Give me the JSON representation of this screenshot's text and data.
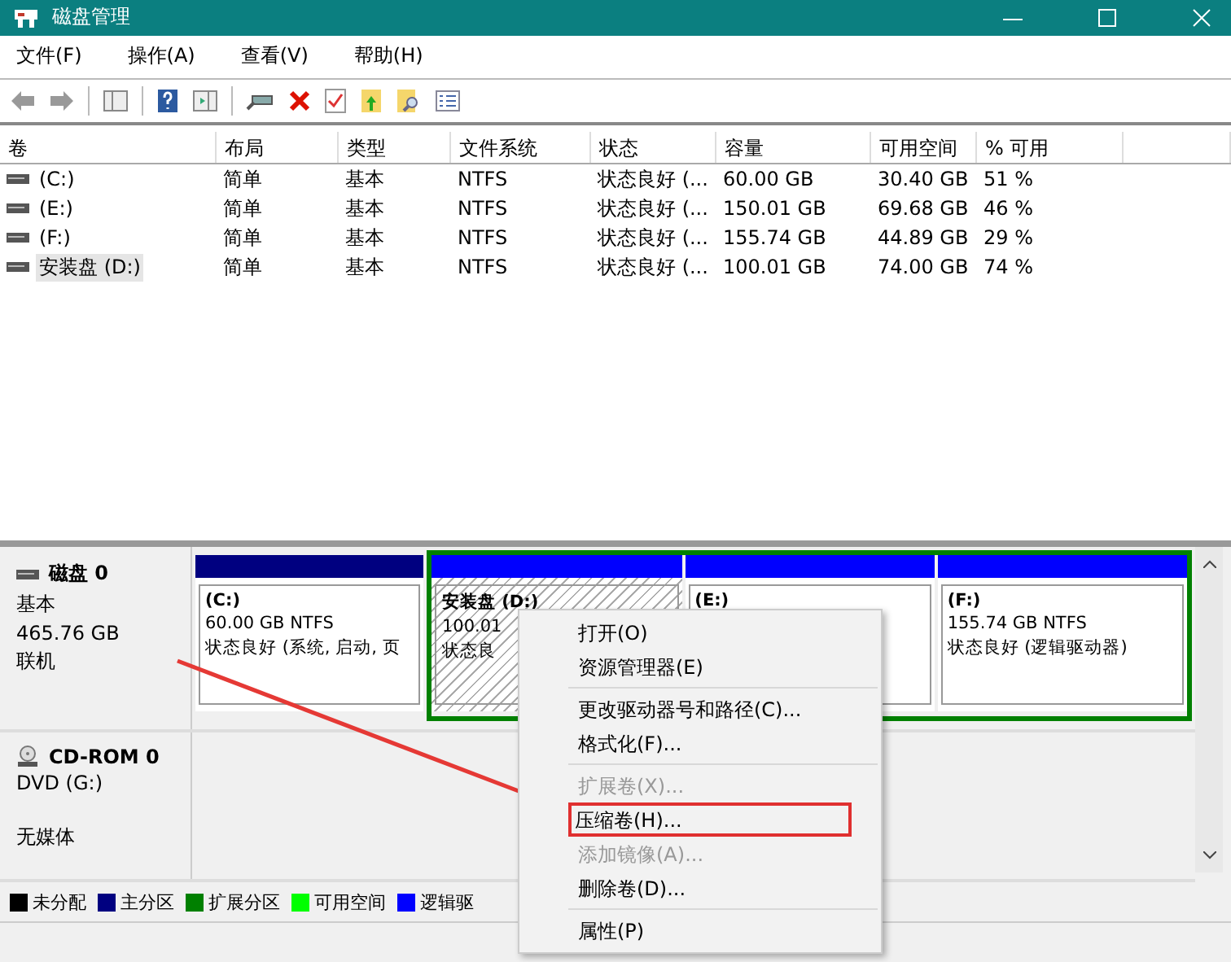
{
  "window": {
    "title": "磁盘管理"
  },
  "menu": [
    "文件(F)",
    "操作(A)",
    "查看(V)",
    "帮助(H)"
  ],
  "table": {
    "columns": [
      "卷",
      "布局",
      "类型",
      "文件系统",
      "状态",
      "容量",
      "可用空间",
      "% 可用"
    ],
    "rows": [
      {
        "selected": false,
        "cells": [
          "(C:)",
          "简单",
          "基本",
          "NTFS",
          "状态良好 (...",
          "60.00 GB",
          "30.40 GB",
          "51 %"
        ]
      },
      {
        "selected": false,
        "cells": [
          "(E:)",
          "简单",
          "基本",
          "NTFS",
          "状态良好 (...",
          "150.01 GB",
          "69.68 GB",
          "46 %"
        ]
      },
      {
        "selected": false,
        "cells": [
          "(F:)",
          "简单",
          "基本",
          "NTFS",
          "状态良好 (...",
          "155.74 GB",
          "44.89 GB",
          "29 %"
        ]
      },
      {
        "selected": true,
        "cells": [
          "安装盘 (D:)",
          "简单",
          "基本",
          "NTFS",
          "状态良好 (...",
          "100.01 GB",
          "74.00 GB",
          "74 %"
        ]
      }
    ]
  },
  "disks": [
    {
      "kind": "disk",
      "name": "磁盘 0",
      "type": "基本",
      "size": "465.76 GB",
      "status": "联机",
      "partitions": [
        {
          "kind": "primary",
          "label": "(C:)",
          "size_fs": "60.00 GB NTFS",
          "status": "状态良好 (系统, 启动, 页",
          "selected": false
        },
        {
          "kind": "extended",
          "children": [
            {
              "kind": "logical",
              "label": "安装盘  (D:)",
              "size_fs": "100.01",
              "status": "状态良",
              "selected": true
            },
            {
              "kind": "logical",
              "label": "(E:)",
              "selected": false
            },
            {
              "kind": "logical",
              "label": "(F:)",
              "size_fs": "155.74 GB NTFS",
              "status": "状态良好 (逻辑驱动器)",
              "selected": false
            }
          ]
        }
      ]
    },
    {
      "kind": "cdrom",
      "name": "CD-ROM 0",
      "type": "DVD (G:)",
      "status": "无媒体"
    }
  ],
  "legend": [
    {
      "label": "未分配",
      "color": "#000000"
    },
    {
      "label": "主分区",
      "color": "#000080"
    },
    {
      "label": "扩展分区",
      "color": "#008000"
    },
    {
      "label": "可用空间",
      "color": "#00ff00"
    },
    {
      "label": "逻辑驱",
      "color": "#0000ff"
    }
  ],
  "context_menu": [
    {
      "label": "打开(O)",
      "disabled": false,
      "selected": false,
      "separator_before": false
    },
    {
      "label": "资源管理器(E)",
      "disabled": false,
      "selected": false,
      "separator_before": false
    },
    {
      "label": "更改驱动器号和路径(C)...",
      "disabled": false,
      "selected": false,
      "separator_before": true
    },
    {
      "label": "格式化(F)...",
      "disabled": false,
      "selected": false,
      "separator_before": false
    },
    {
      "label": "扩展卷(X)...",
      "disabled": true,
      "selected": false,
      "separator_before": true
    },
    {
      "label": "压缩卷(H)...",
      "disabled": false,
      "selected": true,
      "separator_before": false
    },
    {
      "label": "添加镜像(A)...",
      "disabled": true,
      "selected": false,
      "separator_before": false
    },
    {
      "label": "删除卷(D)...",
      "disabled": false,
      "selected": false,
      "separator_before": false
    },
    {
      "label": "属性(P)",
      "disabled": false,
      "selected": false,
      "separator_before": true
    }
  ]
}
